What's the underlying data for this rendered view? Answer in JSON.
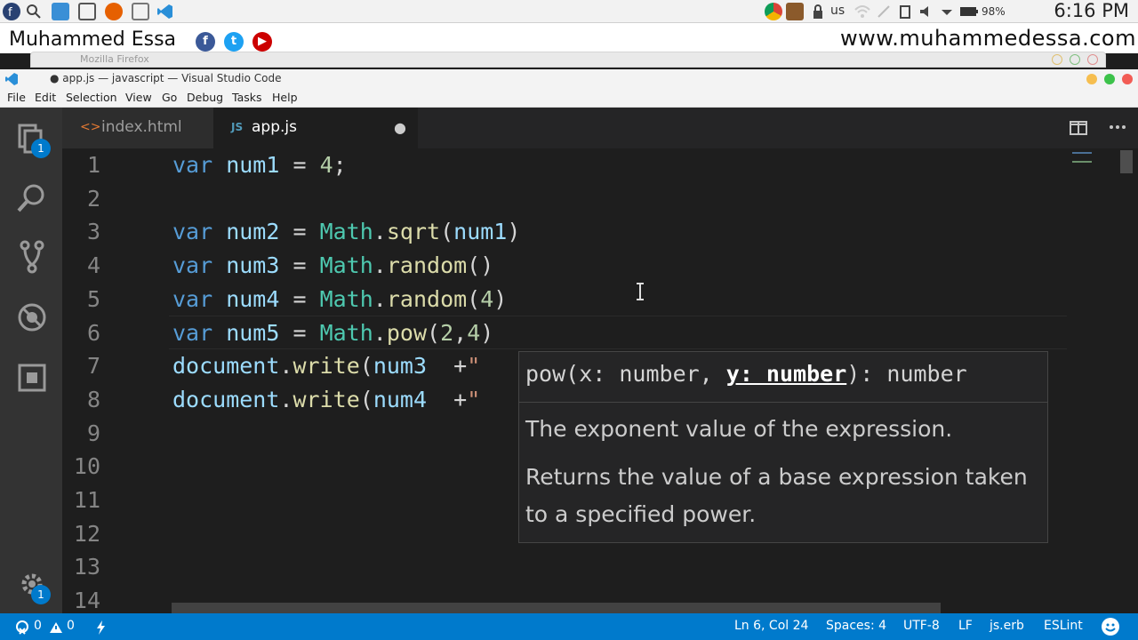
{
  "os_bar": {
    "keyboard_layout": "us",
    "battery": "98%",
    "clock": "6:16 PM"
  },
  "banner": {
    "name": "Muhammed Essa",
    "url": "www.muhammedessa.com"
  },
  "firefox": {
    "title": "Mozilla Firefox"
  },
  "window": {
    "title": "● app.js — javascript — Visual Studio Code"
  },
  "menu": [
    "File",
    "Edit",
    "Selection",
    "View",
    "Go",
    "Debug",
    "Tasks",
    "Help"
  ],
  "activity_bar": {
    "explorer_badge": "1",
    "settings_badge": "1"
  },
  "tabs": [
    {
      "icon": "<>",
      "label": "index.html",
      "active": false
    },
    {
      "icon": "JS",
      "label": "app.js",
      "active": true,
      "dirty_marker": "●"
    }
  ],
  "editor": {
    "line_numbers": [
      "1",
      "2",
      "3",
      "4",
      "5",
      "6",
      "7",
      "8",
      "9",
      "10",
      "11",
      "12",
      "13",
      "14"
    ],
    "lines": [
      [
        {
          "t": "var",
          "c": "kw"
        },
        {
          "t": " num1",
          "c": "vr"
        },
        {
          "t": " = ",
          "c": "op"
        },
        {
          "t": "4",
          "c": "nm"
        },
        {
          "t": ";",
          "c": "op"
        }
      ],
      [],
      [
        {
          "t": "var",
          "c": "kw"
        },
        {
          "t": " num2",
          "c": "vr"
        },
        {
          "t": " = ",
          "c": "op"
        },
        {
          "t": "Math",
          "c": "cl"
        },
        {
          "t": ".",
          "c": "op"
        },
        {
          "t": "sqrt",
          "c": "fn"
        },
        {
          "t": "(",
          "c": "op"
        },
        {
          "t": "num1",
          "c": "vr"
        },
        {
          "t": ")",
          "c": "op"
        }
      ],
      [
        {
          "t": "var",
          "c": "kw"
        },
        {
          "t": " num3",
          "c": "vr"
        },
        {
          "t": " = ",
          "c": "op"
        },
        {
          "t": "Math",
          "c": "cl"
        },
        {
          "t": ".",
          "c": "op"
        },
        {
          "t": "random",
          "c": "fn"
        },
        {
          "t": "()",
          "c": "op"
        }
      ],
      [
        {
          "t": "var",
          "c": "kw"
        },
        {
          "t": " num4",
          "c": "vr"
        },
        {
          "t": " = ",
          "c": "op"
        },
        {
          "t": "Math",
          "c": "cl"
        },
        {
          "t": ".",
          "c": "op"
        },
        {
          "t": "random",
          "c": "fn"
        },
        {
          "t": "(",
          "c": "op"
        },
        {
          "t": "4",
          "c": "nm"
        },
        {
          "t": ")",
          "c": "op"
        }
      ],
      [
        {
          "t": "var",
          "c": "kw"
        },
        {
          "t": " num5",
          "c": "vr"
        },
        {
          "t": " = ",
          "c": "op"
        },
        {
          "t": "Math",
          "c": "cl"
        },
        {
          "t": ".",
          "c": "op"
        },
        {
          "t": "pow",
          "c": "fn"
        },
        {
          "t": "(",
          "c": "op"
        },
        {
          "t": "2",
          "c": "nm"
        },
        {
          "t": ",",
          "c": "op"
        },
        {
          "t": "4",
          "c": "nm"
        },
        {
          "t": ")",
          "c": "op"
        }
      ],
      [
        {
          "t": "document",
          "c": "vr"
        },
        {
          "t": ".",
          "c": "op"
        },
        {
          "t": "write",
          "c": "fn"
        },
        {
          "t": "(",
          "c": "op"
        },
        {
          "t": "num3",
          "c": "vr"
        },
        {
          "t": "  +",
          "c": "op"
        },
        {
          "t": "\"",
          "c": "st"
        }
      ],
      [
        {
          "t": "document",
          "c": "vr"
        },
        {
          "t": ".",
          "c": "op"
        },
        {
          "t": "write",
          "c": "fn"
        },
        {
          "t": "(",
          "c": "op"
        },
        {
          "t": "num4",
          "c": "vr"
        },
        {
          "t": "  +",
          "c": "op"
        },
        {
          "t": "\"",
          "c": "st"
        }
      ],
      [],
      [],
      [],
      [],
      [],
      []
    ]
  },
  "tooltip": {
    "sig_prefix": "pow(x: number, ",
    "sig_param": "y: number",
    "sig_suffix": "): number",
    "doc1": "The exponent value of the expression.",
    "doc2": "Returns the value of a base expression taken to a specified power."
  },
  "status": {
    "errors": "0",
    "warnings": "0",
    "position": "Ln 6, Col 24",
    "spaces": "Spaces: 4",
    "encoding": "UTF-8",
    "eol": "LF",
    "language": "js.erb",
    "linter": "ESLint"
  },
  "colors": {
    "accent": "#007acc",
    "editor_bg": "#1e1e1e",
    "keyword": "#569cd6",
    "class": "#4ec9b0",
    "function": "#dcdcaa"
  }
}
